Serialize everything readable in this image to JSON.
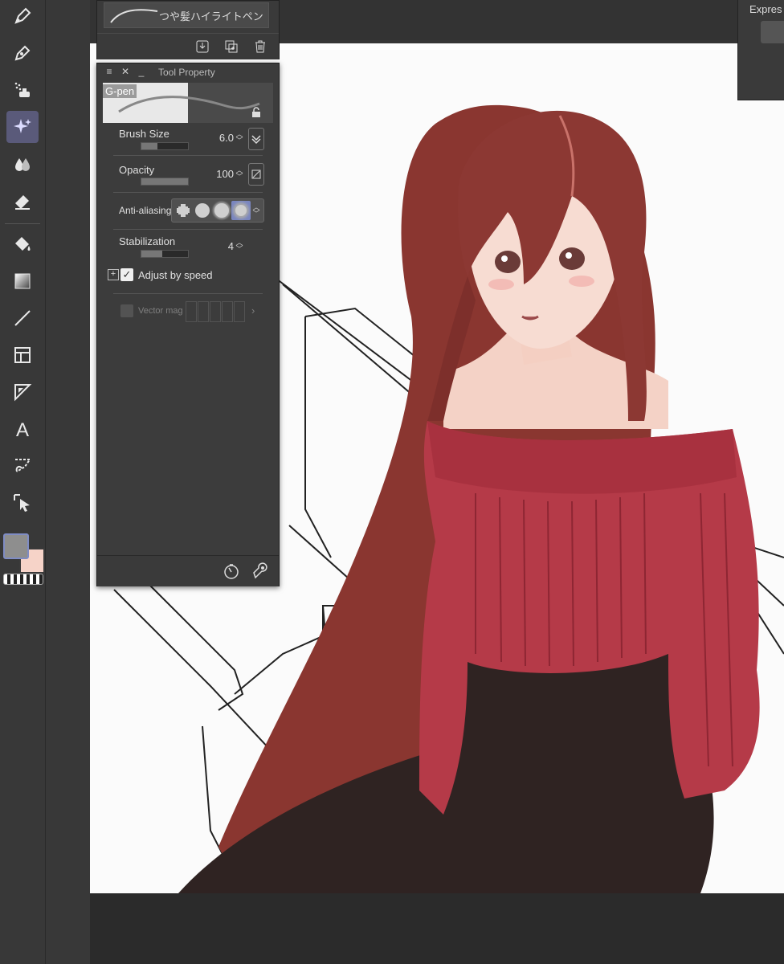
{
  "toolbar": {
    "tools": [
      {
        "name": "pen-tool",
        "icon": "pen-nib-icon"
      },
      {
        "name": "pencil-tool",
        "icon": "pencil-icon"
      },
      {
        "name": "airbrush-tool",
        "icon": "airbrush-icon"
      },
      {
        "name": "decoration-tool",
        "icon": "sparkle-icon",
        "active": true
      },
      {
        "name": "blend-tool",
        "icon": "drops-icon"
      },
      {
        "name": "eraser-tool",
        "icon": "eraser-icon"
      },
      {
        "name": "fill-tool",
        "icon": "paint-bucket-icon"
      },
      {
        "name": "gradient-tool",
        "icon": "gradient-icon"
      },
      {
        "name": "figure-tool",
        "icon": "line-icon"
      },
      {
        "name": "frame-border-tool",
        "icon": "frame-icon"
      },
      {
        "name": "ruler-tool",
        "icon": "ruler-icon"
      },
      {
        "name": "text-tool",
        "icon": "text-icon"
      },
      {
        "name": "lasso-tool",
        "icon": "lasso-icon"
      },
      {
        "name": "operation-tool",
        "icon": "select-arrow-icon"
      }
    ],
    "main_color": "#8e8e8e",
    "sub_color": "#f6d3c8"
  },
  "brush_panel": {
    "brush_name": "つや髪ハイライトペン"
  },
  "expression_panel": {
    "label": "Expres"
  },
  "tool_property": {
    "title": "Tool Property",
    "preview_label": "G-pen",
    "brush_size": {
      "label": "Brush Size",
      "value": "6.0",
      "fill": 0.35
    },
    "opacity": {
      "label": "Opacity",
      "value": "100",
      "fill": 1.0
    },
    "anti_aliasing": {
      "label": "Anti-aliasing",
      "selected_index": 3
    },
    "stabilization": {
      "label": "Stabilization",
      "value": "4",
      "fill": 0.45
    },
    "adjust_by_speed": {
      "label": "Adjust by speed",
      "checked": true
    },
    "vector_magnet": {
      "label": "Vector mag"
    }
  },
  "colors": {
    "panel": "#3c3c3c",
    "accent": "#7a86c0",
    "canvas": "#fbfbfb"
  }
}
